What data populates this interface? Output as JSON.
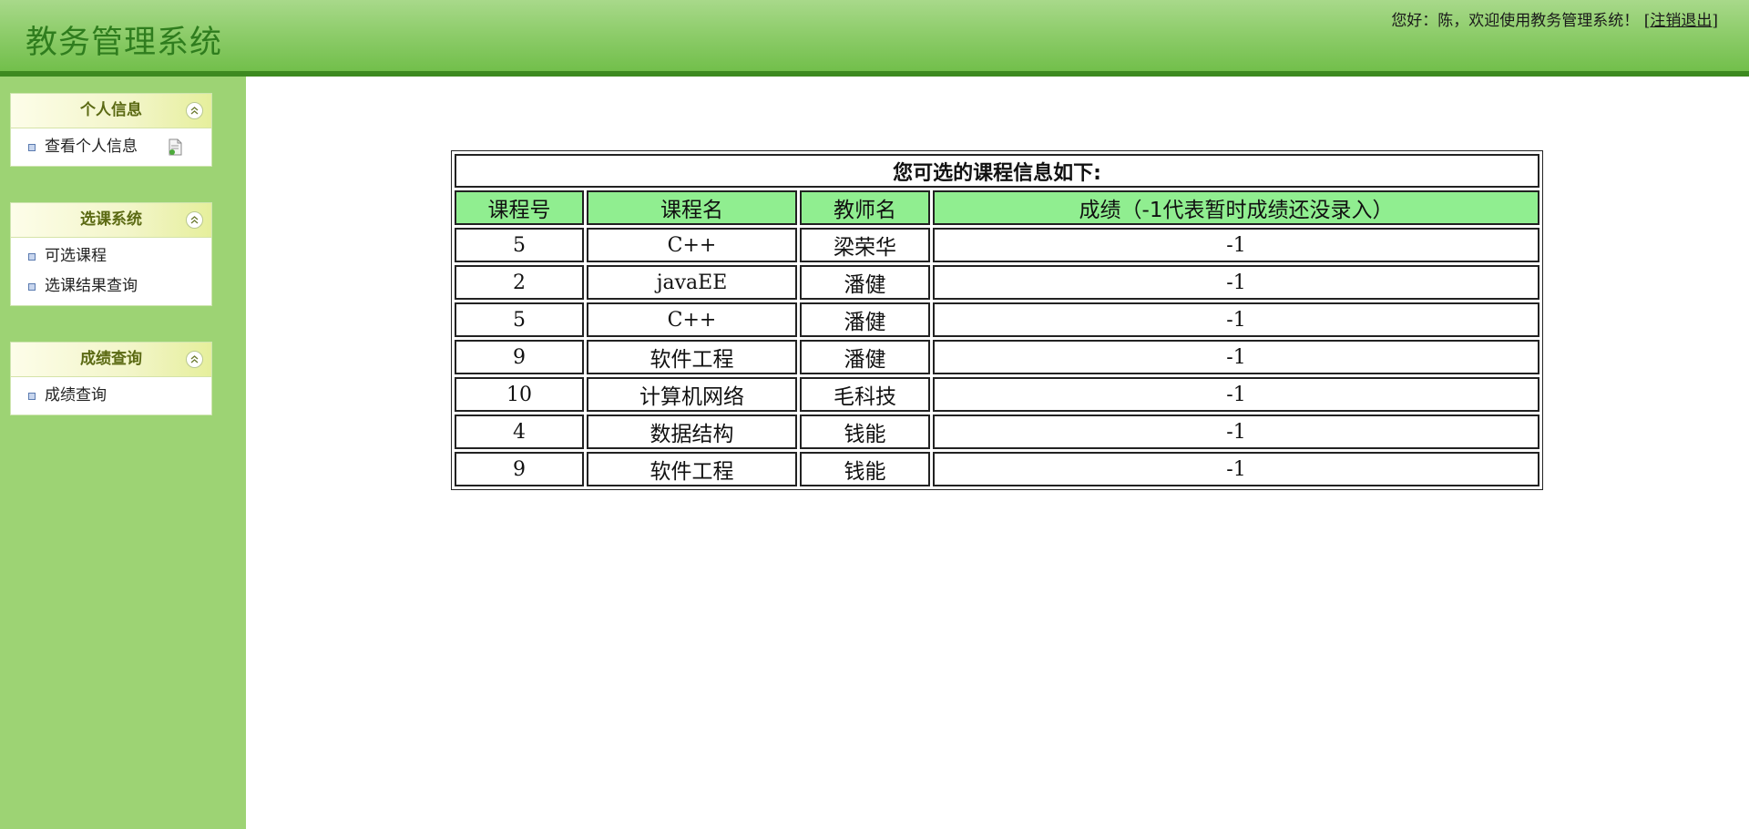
{
  "app": {
    "title": "教务管理系统",
    "welcome_prefix": "您好：陈，欢迎使用教务管理系统！ [",
    "logout_label": "注销退出",
    "welcome_suffix": "]"
  },
  "sidebar": {
    "panels": [
      {
        "title": "个人信息",
        "items": [
          {
            "label": "查看个人信息",
            "icon": "document-icon"
          }
        ]
      },
      {
        "title": "选课系统",
        "items": [
          {
            "label": "可选课程"
          },
          {
            "label": "选课结果查询"
          }
        ]
      },
      {
        "title": "成绩查询",
        "items": [
          {
            "label": "成绩查询"
          }
        ]
      }
    ]
  },
  "table": {
    "caption": "您可选的课程信息如下:",
    "headers": [
      "课程号",
      "课程名",
      "教师名",
      "成绩（-1代表暂时成绩还没录入）"
    ],
    "rows": [
      [
        "5",
        "C++",
        "梁荣华",
        "-1"
      ],
      [
        "2",
        "javaEE",
        "潘健",
        "-1"
      ],
      [
        "5",
        "C++",
        "潘健",
        "-1"
      ],
      [
        "9",
        "软件工程",
        "潘健",
        "-1"
      ],
      [
        "10",
        "计算机网络",
        "毛科技",
        "-1"
      ],
      [
        "4",
        "数据结构",
        "钱能",
        "-1"
      ],
      [
        "9",
        "软件工程",
        "钱能",
        "-1"
      ]
    ]
  },
  "colors": {
    "header_green": "#8fcd6c",
    "header_border": "#3d8a20",
    "sidebar_green": "#9dd374",
    "table_header_bg": "#90ee90"
  }
}
